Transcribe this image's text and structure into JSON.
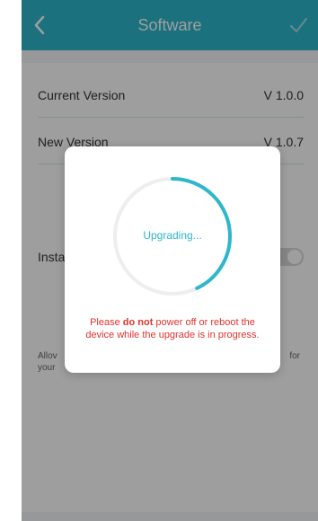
{
  "header": {
    "title": "Software",
    "back_icon": "chevron-left-icon",
    "done_icon": "check-icon"
  },
  "rows": {
    "current_label": "Current Version",
    "current_value": "V 1.0.0",
    "new_label": "New Version",
    "new_value": "V 1.0.7",
    "install_label": "Insta"
  },
  "description": {
    "left": "Allov your",
    "right": "for"
  },
  "modal": {
    "progress_label": "Upgrading...",
    "progress_fraction": 0.43,
    "warning_before": "Please ",
    "warning_bold": "do not",
    "warning_after": " power off or reboot the device while the upgrade is in progress."
  },
  "colors": {
    "accent": "#2db7ca",
    "warning": "#e2332c"
  }
}
